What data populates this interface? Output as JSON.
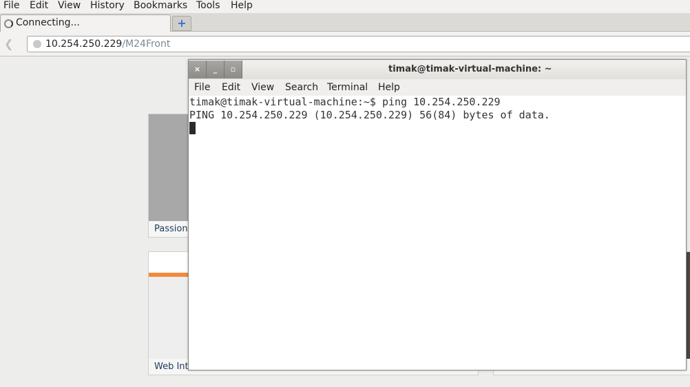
{
  "browser": {
    "menu": [
      "File",
      "Edit",
      "View",
      "History",
      "Bookmarks",
      "Tools",
      "Help"
    ],
    "tab_title": "Connecting...",
    "new_tab_icon": "plus-icon",
    "url_host": "10.254.250.229",
    "url_path": "/M24Front"
  },
  "tiles": [
    {
      "label": "Passion (I"
    },
    {
      "label": "Web Inte"
    }
  ],
  "terminal": {
    "title": "timak@timak-virtual-machine: ~",
    "buttons": [
      "×",
      "_",
      "▫"
    ],
    "menu": [
      "File",
      "Edit",
      "View",
      "Search",
      "Terminal",
      "Help"
    ],
    "lines": [
      "timak@timak-virtual-machine:~$ ping 10.254.250.229",
      "PING 10.254.250.229 (10.254.250.229) 56(84) bytes of data."
    ]
  }
}
